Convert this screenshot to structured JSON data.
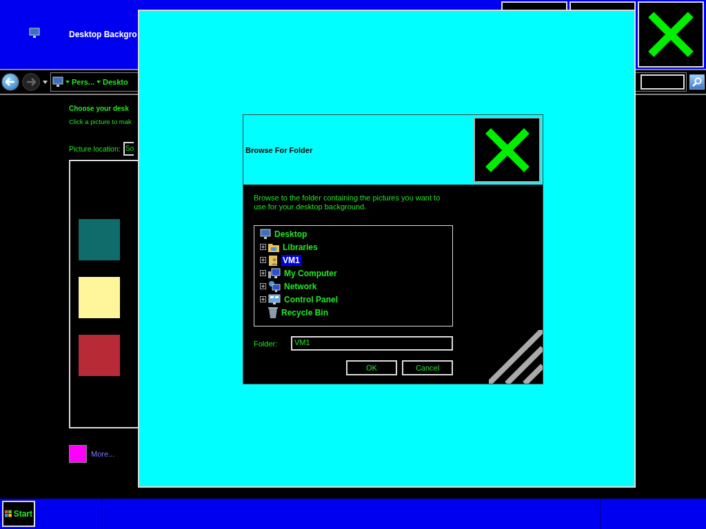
{
  "window": {
    "title": "Desktop Backgro"
  },
  "address_bar": {
    "breadcrumbs": [
      "Pers...",
      "Deskto"
    ]
  },
  "content": {
    "heading": "Choose your desk",
    "subtitle": "Click a picture to mak",
    "location_label": "Picture location:",
    "location_value": "So",
    "swatches": [
      {
        "color": "#106b6b"
      },
      {
        "color": "#fff59a"
      },
      {
        "color": "#b82a35"
      }
    ],
    "more": {
      "label": "More...",
      "color": "#ff00ff"
    }
  },
  "taskbar": {
    "start": "Start"
  },
  "dialog": {
    "title": "Browse For Folder",
    "instructions": "Browse to the folder containing the pictures you want to use for your desktop background.",
    "tree": [
      {
        "label": "Desktop",
        "selected": false,
        "children": [
          {
            "label": "Libraries",
            "expandable": true,
            "selected": false
          },
          {
            "label": "VM1",
            "expandable": true,
            "selected": true
          },
          {
            "label": "My Computer",
            "expandable": true,
            "selected": false
          },
          {
            "label": "Network",
            "expandable": true,
            "selected": false
          },
          {
            "label": "Control Panel",
            "expandable": true,
            "selected": false
          },
          {
            "label": "Recycle Bin",
            "expandable": false,
            "selected": false
          }
        ]
      }
    ],
    "folder_label": "Folder:",
    "folder_value": "VM1",
    "buttons": [
      {
        "label": "OK"
      },
      {
        "label": "Cancel"
      }
    ]
  }
}
